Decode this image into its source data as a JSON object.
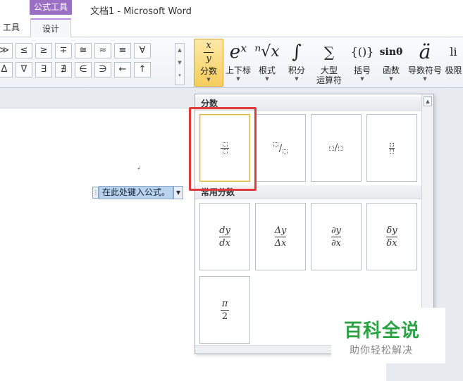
{
  "titlebar": {
    "context_group": "公式工具",
    "document_title": "文档1 - Microsoft Word"
  },
  "tabs": {
    "tools": "工具",
    "design": "设计"
  },
  "symbols": {
    "row1": [
      "≫",
      "≤",
      "≥",
      "∓",
      "≅",
      "≈",
      "≡",
      "∀"
    ],
    "row2": [
      "Δ",
      "∇",
      "∃",
      "∄",
      "∈",
      "∋",
      "←",
      "↑"
    ]
  },
  "ribbon": {
    "buttons": [
      {
        "label": "分数",
        "glyph_top": "x",
        "glyph_bottom": "y"
      },
      {
        "label": "上下标",
        "glyph": "eˣ"
      },
      {
        "label": "根式",
        "glyph": "ⁿ√x"
      },
      {
        "label": "积分",
        "glyph": "∫"
      },
      {
        "label": "大型",
        "label2": "运算符",
        "glyph": "∑"
      },
      {
        "label": "括号",
        "glyph": "{()}"
      },
      {
        "label": "函数",
        "glyph": "sinθ"
      },
      {
        "label": "导数符号",
        "glyph": "ä"
      },
      {
        "label": "极限",
        "glyph": "li"
      }
    ]
  },
  "equation": {
    "placeholder": "在此处键入公式。"
  },
  "gallery": {
    "section_fraction": "分数",
    "section_common": "常用分数",
    "common": [
      {
        "num": "dy",
        "den": "dx"
      },
      {
        "num": "Δy",
        "den": "Δx"
      },
      {
        "num": "∂y",
        "den": "∂x"
      },
      {
        "num": "δy",
        "den": "δx"
      },
      {
        "num": "π",
        "den": "2"
      }
    ]
  },
  "watermark": {
    "title": "百科全说",
    "subtitle": "助你轻松解决"
  }
}
